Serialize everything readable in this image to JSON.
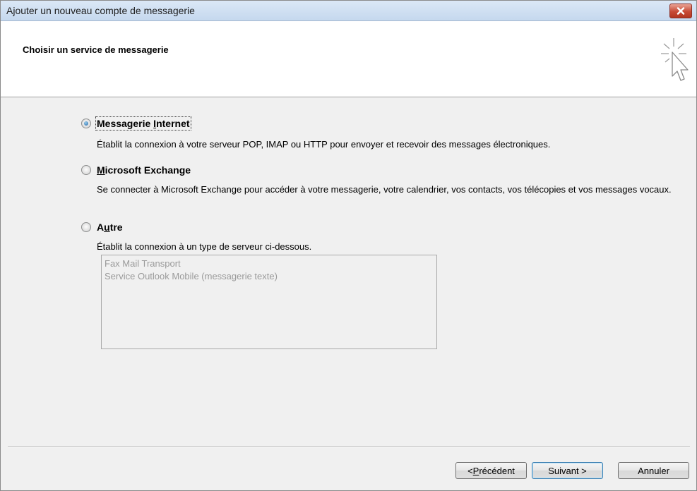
{
  "window": {
    "title": "Ajouter un nouveau compte de messagerie",
    "close_icon": "close-icon"
  },
  "header": {
    "title": "Choisir un service de messagerie",
    "icon": "wizard-cursor-icon"
  },
  "options": [
    {
      "label_pre": "Messagerie ",
      "label_u": "I",
      "label_post": "nternet",
      "selected": true,
      "description": "Établit la connexion à votre serveur POP, IMAP ou HTTP pour envoyer et recevoir des messages électroniques."
    },
    {
      "label_pre": "",
      "label_u": "M",
      "label_post": "icrosoft Exchange",
      "selected": false,
      "description": "Se connecter à Microsoft Exchange pour accéder à votre messagerie, votre calendrier, vos contacts, vos télécopies et vos messages vocaux."
    },
    {
      "label_pre": "A",
      "label_u": "u",
      "label_post": "tre",
      "selected": false,
      "description": "Établit la connexion à un type de serveur ci-dessous."
    }
  ],
  "other_services": [
    "Fax Mail Transport",
    "Service Outlook Mobile (messagerie texte)"
  ],
  "buttons": {
    "back_pre": "< ",
    "back_u": "P",
    "back_post": "récédent",
    "next": "Suivant >",
    "cancel": "Annuler"
  }
}
